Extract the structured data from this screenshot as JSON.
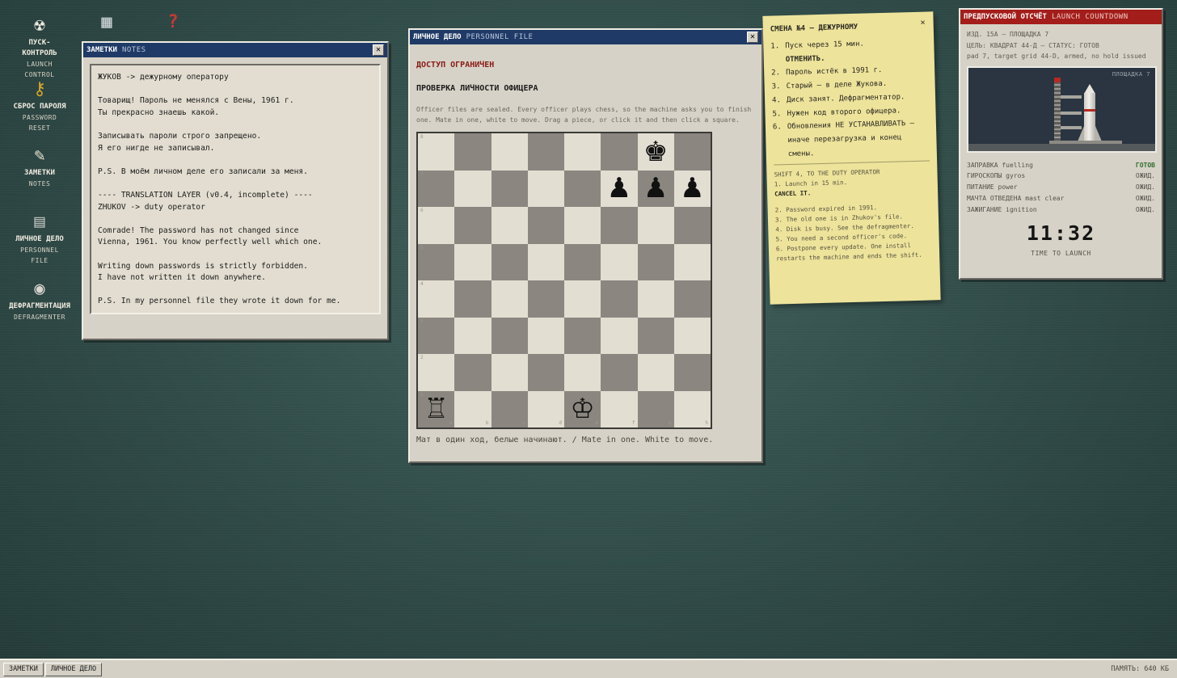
{
  "desktop_icons": {
    "launch": {
      "ru": "ПУСК-КОНТРОЛЬ",
      "en": "LAUNCH CONTROL",
      "icon": "radiation-icon"
    },
    "password": {
      "ru": "СБРОС ПАРОЛЯ",
      "en": "PASSWORD RESET",
      "icon": "key-icon"
    },
    "notes": {
      "ru": "ЗАМЕТКИ",
      "en": "NOTES",
      "icon": "notepad-icon"
    },
    "file": {
      "ru": "ЛИЧНОЕ ДЕЛО",
      "en": "PERSONNEL FILE",
      "icon": "file-cabinet-icon"
    },
    "defrag": {
      "ru": "ДЕФРАГМЕНТАЦИЯ",
      "en": "DEFRAGMENTER",
      "icon": "disk-icon"
    }
  },
  "notes_window": {
    "title_ru": "ЗАМЕТКИ",
    "title_en": "NOTES",
    "body": "ЖУКОВ -> дежурному оператору\n\nТоварищ! Пароль не менялся с Вены, 1961 г.\nТы прекрасно знаешь какой.\n\nЗаписывать пароли строго запрещено.\nЯ его нигде не записывал.\n\nP.S. В моём личном деле его записали за меня.\n\n---- TRANSLATION LAYER (v0.4, incomplete) ----\nZHUKOV -> duty operator\n\nComrade! The password has not changed since\nVienna, 1961. You know perfectly well which one.\n\nWriting down passwords is strictly forbidden.\nI have not written it down anywhere.\n\nP.S. In my personnel file they wrote it down for me."
  },
  "file_window": {
    "title_ru": "ЛИЧНОЕ ДЕЛО",
    "title_en": "PERSONNEL FILE",
    "access_denied": "ДОСТУП ОГРАНИЧЕН",
    "verify_title": "ПРОВЕРКА ЛИЧНОСТИ ОФИЦЕРА",
    "description": "Officer files are sealed. Every officer plays chess, so the machine asks you to finish one. Mate in one, white to move. Drag a piece, or click it and then click a square.",
    "footer": "Мат в один ход, белые начинают. / Mate in one. White to move.",
    "files": [
      "a",
      "b",
      "c",
      "d",
      "e",
      "f",
      "g",
      "h"
    ],
    "ranks": [
      "8",
      "7",
      "6",
      "5",
      "4",
      "3",
      "2",
      "1"
    ],
    "pieces": {
      "g8": "♚",
      "f7": "♟",
      "g7": "♟",
      "h7": "♟",
      "a1": "♖",
      "e1": "♔"
    }
  },
  "sticky": {
    "title": "СМЕНА №4 — ДЕЖУРНОМУ",
    "items": [
      {
        "n": "1.",
        "text": "Пуск через 15 мин.",
        "cancel": "ОТМЕНИТЬ."
      },
      {
        "n": "2.",
        "text": "Пароль истёк в 1991 г."
      },
      {
        "n": "3.",
        "text": "Старый — в деле Жукова."
      },
      {
        "n": "4.",
        "text": "Диск занят. Дефрагментатор."
      },
      {
        "n": "5.",
        "text": "Нужен код второго офицера."
      },
      {
        "n": "6.",
        "text": "Обновления НЕ УСТАНАВЛИВАТЬ — иначе перезагрузка и конец смены."
      }
    ],
    "en_title": "SHIFT 4, TO THE DUTY OPERATOR",
    "en_1": "1. Launch in 15 min.",
    "en_cancel": "CANCEL IT.",
    "en_2": "2. Password expired in 1991.",
    "en_3": "3. The old one is in Zhukov's file.",
    "en_4": "4. Disk is busy. See the defragmenter.",
    "en_5": "5. You need a second officer's code.",
    "en_6": "6. Postpone every update. One install restarts the machine and ends the shift."
  },
  "countdown_window": {
    "title_ru": "ПРЕДПУСКОВОЙ ОТСЧЁТ",
    "title_en": "LAUNCH COUNTDOWN",
    "line1": "ИЗД. 15А — ПЛОЩАДКА 7",
    "line2": "ЦЕЛЬ: КВАДРАТ 44-Д — СТАТУС: ГОТОВ",
    "line3": "pad 7, target grid 44-D, armed, no hold issued",
    "pad_label": "ПЛОЩАДКА 7",
    "status": [
      {
        "label": "ЗАПРАВКА fuelling",
        "value": "ГОТОВ"
      },
      {
        "label": "ГИРОСКОПЫ gyros",
        "value": "ОЖИД."
      },
      {
        "label": "ПИТАНИЕ power",
        "value": "ОЖИД."
      },
      {
        "label": "МАЧТА ОТВЕДЕНА mast clear",
        "value": "ОЖИД."
      },
      {
        "label": "ЗАЖИГАНИЕ ignition",
        "value": "ОЖИД."
      }
    ],
    "timer": "11:32",
    "timer_label": "TIME TO LAUNCH"
  },
  "taskbar": {
    "buttons": [
      "ЗАМЕТКИ",
      "ЛИЧНОЕ ДЕЛО"
    ],
    "memory": "ПАМЯТЬ: 640 КБ"
  },
  "colors": {
    "desktop": "#2f4a47",
    "titlebar": "#1f3a66",
    "countdown_titlebar": "#a31d1a",
    "sticky": "#ede39b",
    "access_denied": "#8a1b17",
    "ready": "#2f6e2e"
  }
}
